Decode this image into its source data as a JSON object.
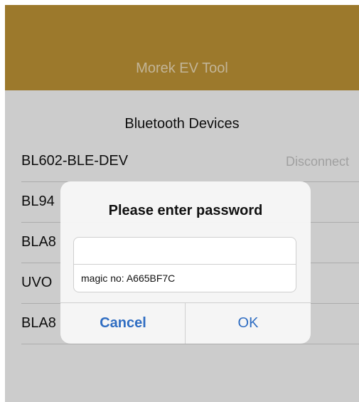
{
  "app": {
    "title": "Morek EV Tool"
  },
  "section": {
    "title": "Bluetooth Devices"
  },
  "devices": [
    {
      "name": "BL602-BLE-DEV",
      "action": "Disconnect"
    },
    {
      "name": "BL94",
      "action": ""
    },
    {
      "name": "BLA8",
      "action": ""
    },
    {
      "name": "UVO",
      "action": ""
    },
    {
      "name": "BLA8",
      "action": ""
    }
  ],
  "dialog": {
    "title": "Please enter password",
    "password_value": "",
    "magic_text": "magic no: A665BF7C",
    "cancel_label": "Cancel",
    "ok_label": "OK"
  },
  "colors": {
    "nav_bar": "#c49838",
    "nav_title": "#f3e1bc",
    "button_text": "#2f6dc2"
  }
}
